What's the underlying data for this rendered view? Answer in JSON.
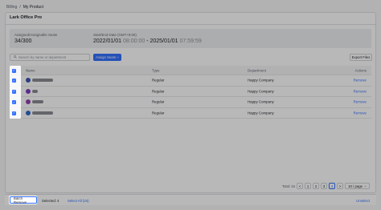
{
  "breadcrumb": {
    "parent": "Billing",
    "separator": "/",
    "current": "My Product"
  },
  "card": {
    "title": "Lark Office Pro"
  },
  "summary": {
    "assigned_label": "Assigned/Assignable Seats",
    "assigned_value": "34/300",
    "period_label": "Start/End Date",
    "period_tz": "(GMT+8:00)",
    "start_date": "2022/01/01",
    "start_time": "08:00:00",
    "dash": " - ",
    "end_date": "2025/01/01",
    "end_time": "07:59:59"
  },
  "toolbar": {
    "search_placeholder": "Search by name or department",
    "assign_label": "Assign Seats",
    "export_label": "Export Files"
  },
  "table": {
    "headers": {
      "name": "Name",
      "type": "Type",
      "department": "Department",
      "actions": "Actions"
    },
    "rows": [
      {
        "type": "Regular",
        "department": "Happy Company",
        "action": "Remove",
        "avatar_color": "#3d56b2"
      },
      {
        "type": "Regular",
        "department": "Happy Company",
        "action": "Remove",
        "avatar_color": "#7b3fc4"
      },
      {
        "type": "Regular",
        "department": "Happy Company",
        "action": "Remove",
        "avatar_color": "#8e44ad"
      },
      {
        "type": "Regular",
        "department": "Happy Company",
        "action": "Remove",
        "avatar_color": "#2e6bc6"
      }
    ]
  },
  "pagination": {
    "total": "Total: 34",
    "prev": "<",
    "pages": [
      "1",
      "2",
      "3",
      "4"
    ],
    "active_page": "4",
    "next": ">",
    "page_size": "10 / page"
  },
  "footer": {
    "batch_remove": "Batch Remove",
    "selected": "Selected: 4",
    "select_all": "Select All (34)",
    "unselect": "Unselect"
  },
  "colors": {
    "accent": "#3370ff",
    "overlay": "rgba(0,0,0,0.28)"
  }
}
